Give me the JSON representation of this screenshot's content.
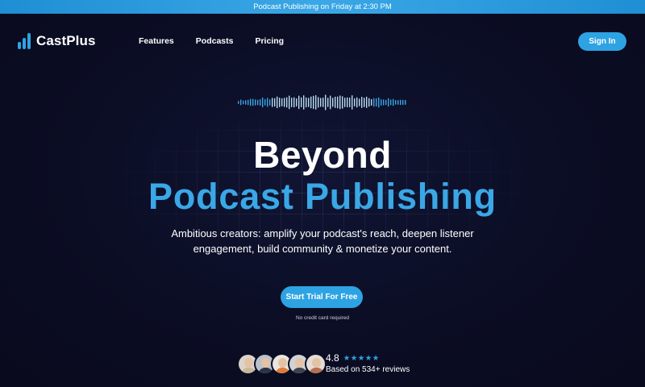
{
  "announcement": {
    "text": "Podcast Publishing on Friday at 2:30 PM"
  },
  "brand": {
    "name": "CastPlus",
    "accent": "#2ea3e3",
    "background": "#0b0d24"
  },
  "nav": {
    "links": [
      {
        "label": "Features"
      },
      {
        "label": "Podcasts"
      },
      {
        "label": "Pricing"
      }
    ],
    "signin_label": "Sign In"
  },
  "hero": {
    "title_line1": "Beyond",
    "title_line2": "Podcast Publishing",
    "subtitle_line1": "Ambitious creators: amplify your podcast's reach, deepen listener",
    "subtitle_line2": "engagement, build community & monetize your content.",
    "cta_label": "Start Trial For Free",
    "cta_note": "No credit card required",
    "icons": [
      "sound-wave-icon"
    ]
  },
  "social_proof": {
    "score": "4.8",
    "stars": "★★★★★",
    "rating": 5,
    "reviews_text": "Based on 534+ reviews",
    "avatars": [
      {
        "name": "reviewer-avatar-1",
        "shirt": "#c9b79a",
        "bg": "#d9d4cc"
      },
      {
        "name": "reviewer-avatar-2",
        "shirt": "#2b3445",
        "bg": "#b9c2cc"
      },
      {
        "name": "reviewer-avatar-3",
        "shirt": "#e07c3a",
        "bg": "#e9e6e1"
      },
      {
        "name": "reviewer-avatar-4",
        "shirt": "#3d4450",
        "bg": "#cfd3d8"
      },
      {
        "name": "reviewer-avatar-5",
        "shirt": "#b56f52",
        "bg": "#e3ddd5"
      }
    ]
  }
}
